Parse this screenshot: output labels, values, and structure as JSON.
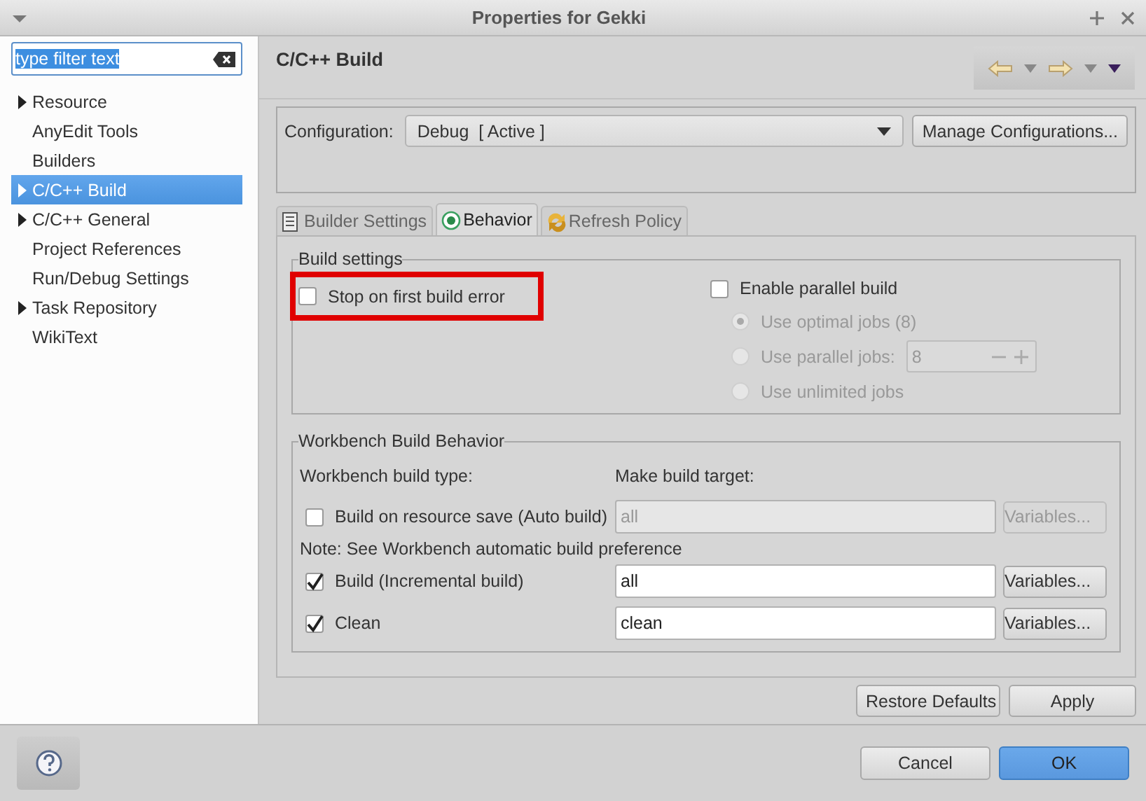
{
  "window": {
    "title": "Properties for Gekki"
  },
  "filter": {
    "value": "type filter text"
  },
  "sidebar": {
    "items": [
      {
        "label": "Resource",
        "expandable": true,
        "selected": false
      },
      {
        "label": "AnyEdit Tools",
        "expandable": false,
        "selected": false
      },
      {
        "label": "Builders",
        "expandable": false,
        "selected": false
      },
      {
        "label": "C/C++ Build",
        "expandable": true,
        "selected": true
      },
      {
        "label": "C/C++ General",
        "expandable": true,
        "selected": false
      },
      {
        "label": "Project References",
        "expandable": false,
        "selected": false
      },
      {
        "label": "Run/Debug Settings",
        "expandable": false,
        "selected": false
      },
      {
        "label": "Task Repository",
        "expandable": true,
        "selected": false
      },
      {
        "label": "WikiText",
        "expandable": false,
        "selected": false
      }
    ]
  },
  "page": {
    "title": "C/C++ Build"
  },
  "configuration": {
    "label": "Configuration:",
    "value": "Debug  [ Active ]",
    "button": "Manage Configurations..."
  },
  "tabs": [
    {
      "label": "Builder Settings",
      "selected": false,
      "kind": "list"
    },
    {
      "label": "Behavior",
      "selected": true,
      "kind": "radio"
    },
    {
      "label": "Refresh Policy",
      "selected": false,
      "kind": "refresh"
    }
  ],
  "build_settings": {
    "title": "Build settings",
    "stop_on_error": {
      "label": "Stop on first build error",
      "checked": false,
      "highlighted": true
    },
    "parallel": {
      "label": "Enable parallel build",
      "checked": false
    },
    "job_options": [
      {
        "label": "Use optimal jobs (8)",
        "selected": true,
        "disabled": true
      },
      {
        "label": "Use parallel jobs:",
        "selected": false,
        "disabled": true,
        "value": "8"
      },
      {
        "label": "Use unlimited jobs",
        "selected": false,
        "disabled": true
      }
    ]
  },
  "workbench": {
    "title": "Workbench Build Behavior",
    "type_header": "Workbench build type:",
    "target_header": "Make build target:",
    "rows": [
      {
        "kind": "option",
        "label": "Build on resource save (Auto build)",
        "checked": false,
        "value": "all",
        "disabled": true,
        "button": "Variables..."
      },
      {
        "kind": "note",
        "label": "Note: See Workbench automatic build preference"
      },
      {
        "kind": "option",
        "label": "Build (Incremental build)",
        "checked": true,
        "value": "all",
        "disabled": false,
        "button": "Variables..."
      },
      {
        "kind": "option",
        "label": "Clean",
        "checked": true,
        "value": "clean",
        "disabled": false,
        "button": "Variables..."
      }
    ]
  },
  "actions": [
    "Restore Defaults",
    "Apply"
  ],
  "footer": {
    "buttons": [
      {
        "label": "Cancel",
        "default": false
      },
      {
        "label": "OK",
        "default": true
      }
    ]
  }
}
